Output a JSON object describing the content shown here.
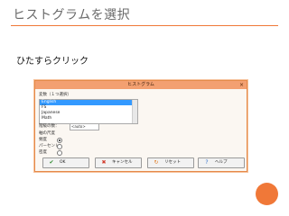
{
  "slide": {
    "title": "ヒストグラムを選択",
    "subtitle": "ひたすらクリック"
  },
  "dialog": {
    "title": "ヒストグラム",
    "close_glyph": "×",
    "variable_label": "変数（１つ選択）",
    "variables": [
      "English",
      "FS",
      "Japanese",
      "Math"
    ],
    "selected_variable": "English",
    "bins_label": "階級の数：",
    "bins_value": "<auto>",
    "axis_label": "軸の尺度",
    "scale_options": [
      {
        "label": "頻度",
        "selected": true
      },
      {
        "label": "パーセント",
        "selected": false
      },
      {
        "label": "密度",
        "selected": false
      }
    ],
    "buttons": {
      "ok": "OK",
      "cancel": "キャンセル",
      "reset": "リセット",
      "help": "ヘルプ"
    },
    "icons": {
      "ok": "check-icon",
      "cancel": "x-icon",
      "reset": "reset-icon",
      "help": "question-icon"
    }
  },
  "colors": {
    "accent": "#f07838",
    "titlebar": "#f3a071",
    "selection": "#3399ff"
  }
}
